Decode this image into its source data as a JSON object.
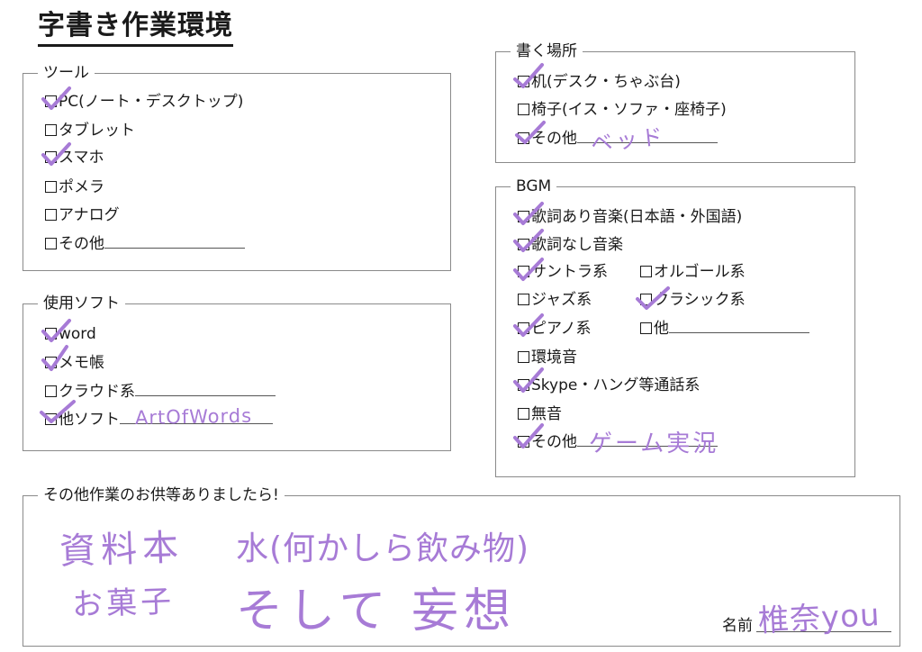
{
  "title": "字書き作業環境",
  "tools": {
    "legend": "ツール",
    "items": [
      "PC(ノート・デスクトップ)",
      "タブレット",
      "スマホ",
      "ポメラ",
      "アナログ",
      "その他"
    ]
  },
  "software": {
    "legend": "使用ソフト",
    "items": [
      "word",
      "メモ帳",
      "クラウド系",
      "他ソフト"
    ],
    "other_value": "ArtOfWords"
  },
  "place": {
    "legend": "書く場所",
    "items": [
      "机(デスク・ちゃぶ台)",
      "椅子(イス・ソファ・座椅子)",
      "その他"
    ],
    "other_value": "ベッド"
  },
  "bgm": {
    "legend": "BGM",
    "items": [
      "歌詞あり音楽(日本語・外国語)",
      "歌詞なし音楽",
      "サントラ系",
      "オルゴール系",
      "ジャズ系",
      "クラシック系",
      "ピアノ系",
      "他",
      "環境音",
      "Skype・ハング等通話系",
      "無音",
      "その他"
    ],
    "other_value": "ゲーム実況"
  },
  "notes": {
    "legend": "その他作業のお供等ありましたら!",
    "line1a": "資料本",
    "line1b": "水(何かしら飲み物)",
    "line2a": "お菓子",
    "line2b": "そして 妄想",
    "name_label": "名前",
    "name_value": "椎奈you"
  },
  "checked": {
    "tools": [
      "PC(ノート・デスクトップ)",
      "スマホ"
    ],
    "software": [
      "word",
      "メモ帳",
      "他ソフト"
    ],
    "place": [
      "机(デスク・ちゃぶ台)",
      "その他"
    ],
    "bgm": [
      "歌詞あり音楽(日本語・外国語)",
      "歌詞なし音楽",
      "サントラ系",
      "クラシック系",
      "ピアノ系",
      "Skype・ハング等通話系",
      "その他"
    ]
  },
  "colors": {
    "ink": "#1a1a1a",
    "handwriting": "#a77bd6",
    "border": "#8a8a8a"
  }
}
